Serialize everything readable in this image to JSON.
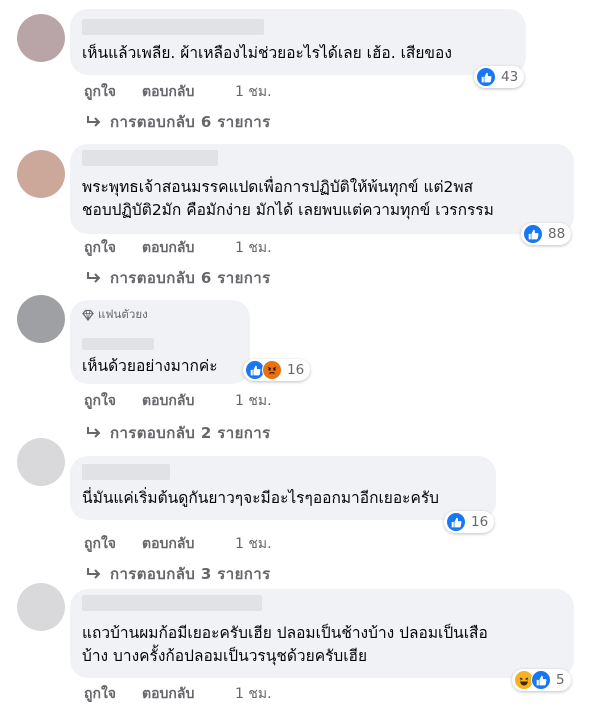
{
  "colors": {
    "bubble": "#f0f2f5",
    "like_blue": "#1877f2",
    "secondary_text": "#65676b"
  },
  "comments": [
    {
      "text_lines": [
        "เห็นแล้วเพลีย. ผ้าเหลืองไม่ช่วยอะไรได้เลย เฮ้อ. เสียของ"
      ],
      "reaction_icons": [
        "like-icon"
      ],
      "reaction_count": "43",
      "like_label": "ถูกใจ",
      "reply_label": "ตอบกลับ",
      "time": "1 ชม.",
      "replies_text": "การตอบกลับ 6 รายการ"
    },
    {
      "text_lines": [
        "พระพุทธเจ้าสอนมรรคแปดเพื่อการปฏิบัติให้พ้นทุกข์ แต่2พส",
        "ชอบปฏิบัติ2มัก คือมักง่าย มักได้ เลยพบแต่ความทุกข์ เวรกรรม"
      ],
      "reaction_icons": [
        "like-icon"
      ],
      "reaction_count": "88",
      "like_label": "ถูกใจ",
      "reply_label": "ตอบกลับ",
      "time": "1 ชม.",
      "replies_text": "การตอบกลับ 6 รายการ"
    },
    {
      "badge": "แฟนตัวยง",
      "text_lines": [
        "เห็นด้วยอย่างมากค่ะ"
      ],
      "reaction_icons": [
        "like-icon",
        "angry-icon"
      ],
      "reaction_count": "16",
      "like_label": "ถูกใจ",
      "reply_label": "ตอบกลับ",
      "time": "1 ชม.",
      "replies_text": "การตอบกลับ 2 รายการ"
    },
    {
      "text_lines": [
        "นี่มันแค่เริ่มต้นดูกันยาวๆจะมีอะไรๆออกมาอีกเยอะครับ"
      ],
      "reaction_icons": [
        "like-icon"
      ],
      "reaction_count": "16",
      "like_label": "ถูกใจ",
      "reply_label": "ตอบกลับ",
      "time": "1 ชม.",
      "replies_text": "การตอบกลับ 3 รายการ"
    },
    {
      "text_lines": [
        "แถวบ้านผมก้อมีเยอะครับเฮีย ปลอมเป็นช้างบ้าง ปลอมเป็นเสือ",
        "บ้าง บางครั้งก้อปลอมเป็นวรนุชด้วยครับเฮีย"
      ],
      "reaction_icons": [
        "haha-icon",
        "like-icon"
      ],
      "reaction_count": "5",
      "like_label": "ถูกใจ",
      "reply_label": "ตอบกลับ",
      "time": "1 ชม."
    }
  ]
}
